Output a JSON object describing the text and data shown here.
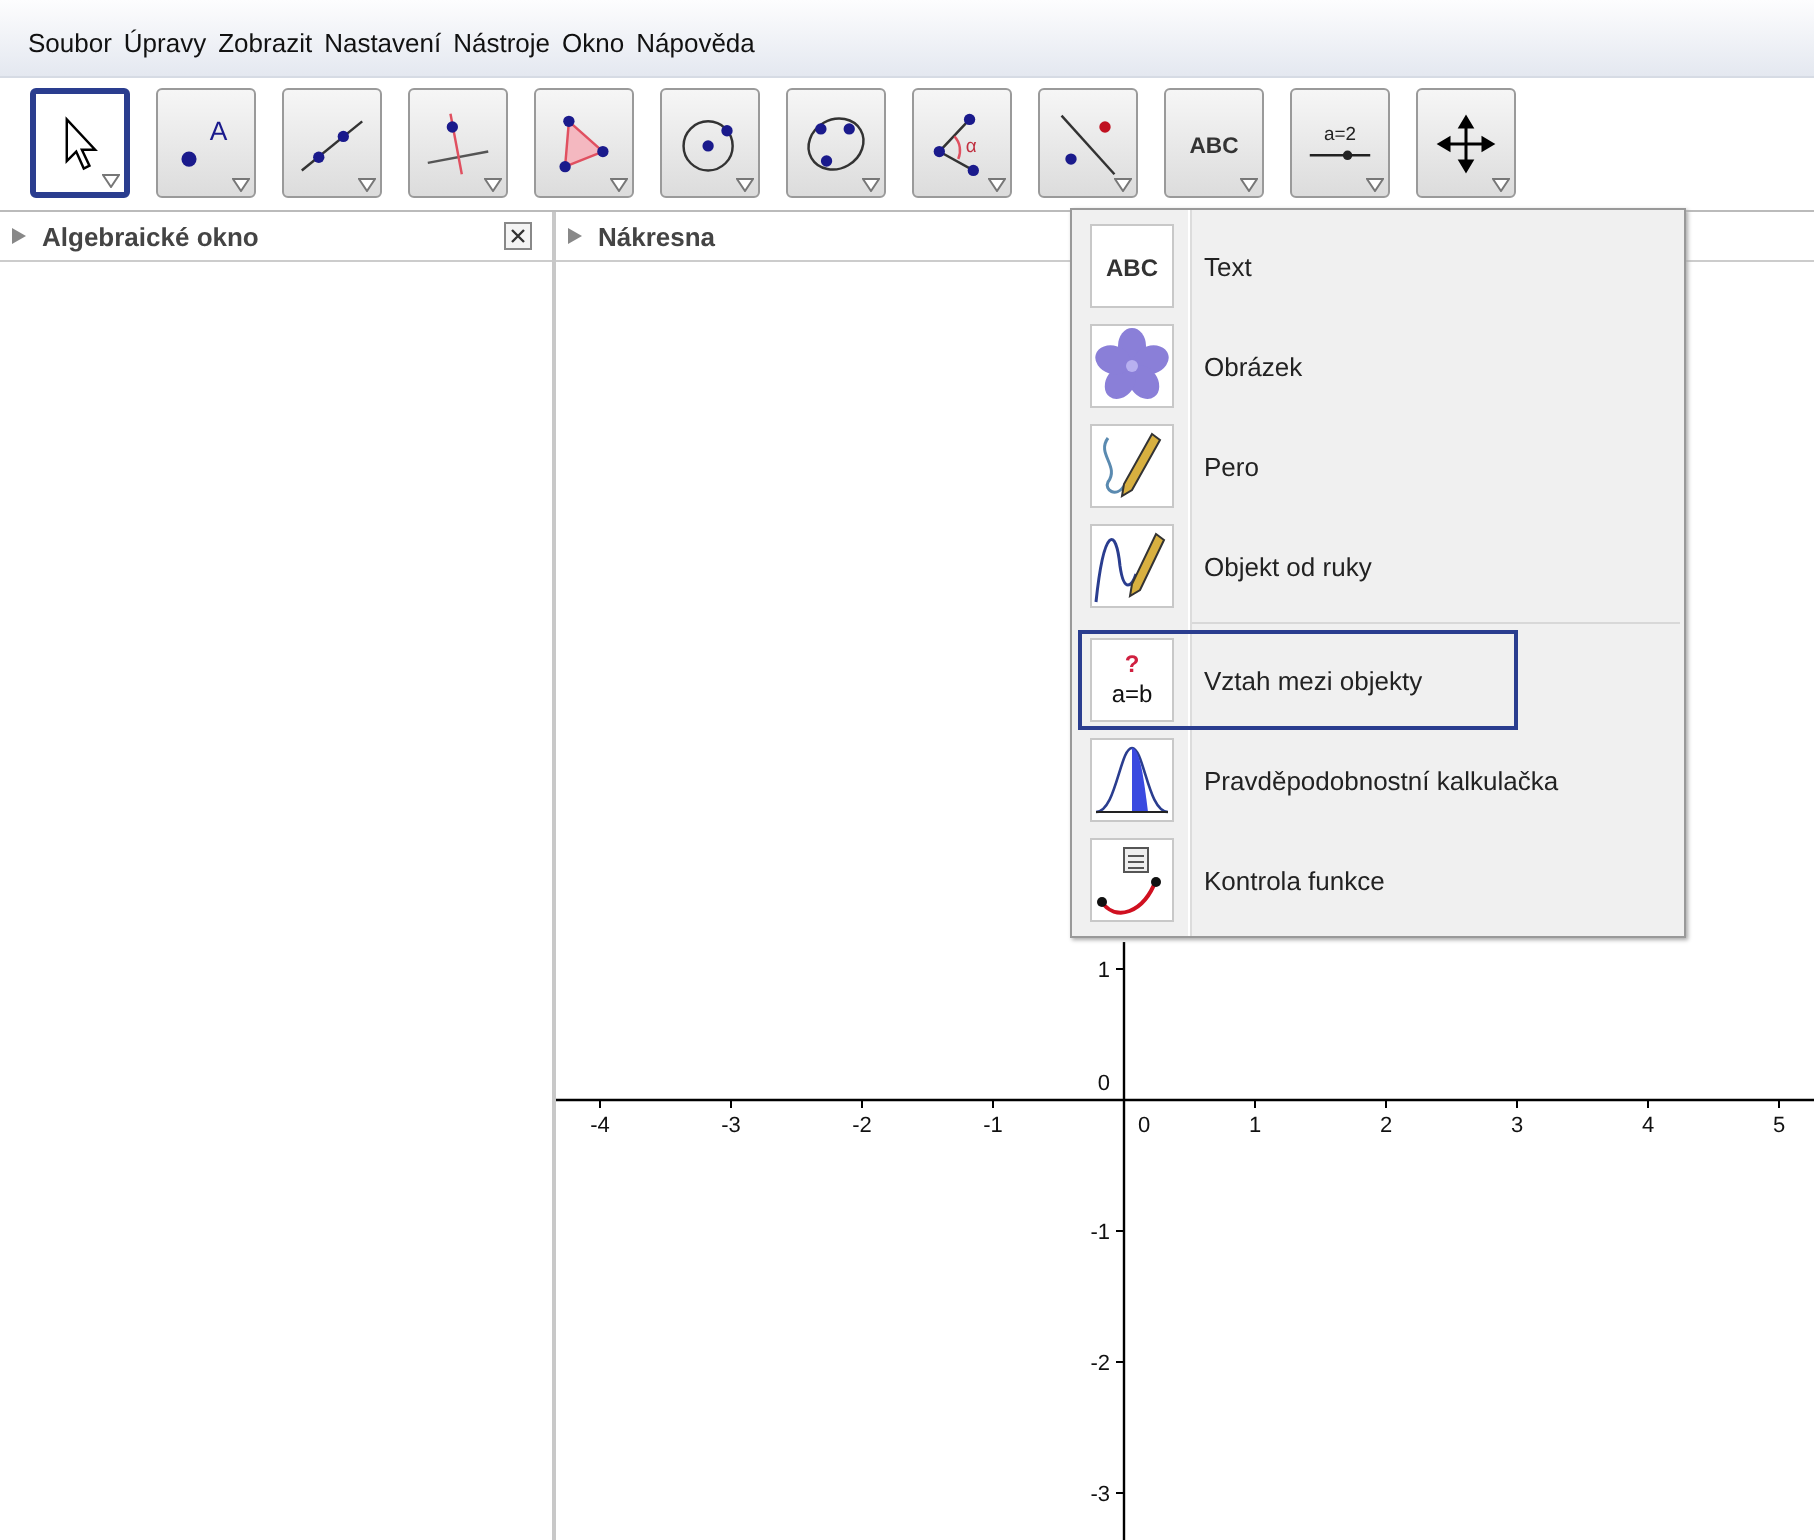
{
  "menu_bar": [
    "Soubor",
    "Úpravy",
    "Zobrazit",
    "Nastavení",
    "Nástroje",
    "Okno",
    "Nápověda"
  ],
  "toolbar": [
    {
      "kind": "move",
      "selected": true
    },
    {
      "kind": "point",
      "selected": false,
      "icon_text": "A"
    },
    {
      "kind": "line",
      "selected": false
    },
    {
      "kind": "perpendicular",
      "selected": false
    },
    {
      "kind": "polygon",
      "selected": false
    },
    {
      "kind": "circle",
      "selected": false
    },
    {
      "kind": "conic",
      "selected": false
    },
    {
      "kind": "angle",
      "selected": false,
      "icon_text": "α"
    },
    {
      "kind": "reflect",
      "selected": false
    },
    {
      "kind": "text",
      "selected": false,
      "icon_text": "ABC"
    },
    {
      "kind": "slider",
      "selected": false,
      "icon_text": "a=2"
    },
    {
      "kind": "move-view",
      "selected": false
    }
  ],
  "algebra_panel": {
    "title": "Algebraické okno"
  },
  "graphics_panel": {
    "title": "Nákresna",
    "x_axis_labels": [
      "-4",
      "-3",
      "-2",
      "-1",
      "0",
      "1",
      "2",
      "3",
      "4",
      "5"
    ],
    "y_axis_labels": [
      "1",
      "0",
      "-1",
      "-2",
      "-3"
    ]
  },
  "tool_menu": [
    {
      "kind": "text",
      "label": "Text",
      "selected": false,
      "icon_text": "ABC"
    },
    {
      "kind": "image",
      "label": "Obrázek",
      "selected": false
    },
    {
      "kind": "pen",
      "label": "Pero",
      "selected": false
    },
    {
      "kind": "freehand",
      "label": "Objekt od ruky",
      "selected": false
    },
    {
      "kind": "relation",
      "label": "Vztah mezi objekty",
      "selected": true,
      "icon_text": "?",
      "icon_text_2": "a=b",
      "separator_before": true
    },
    {
      "kind": "probability",
      "label": "Pravděpodobnostní kalkulačka",
      "selected": false
    },
    {
      "kind": "function",
      "label": "Kontrola funkce",
      "selected": false
    }
  ]
}
